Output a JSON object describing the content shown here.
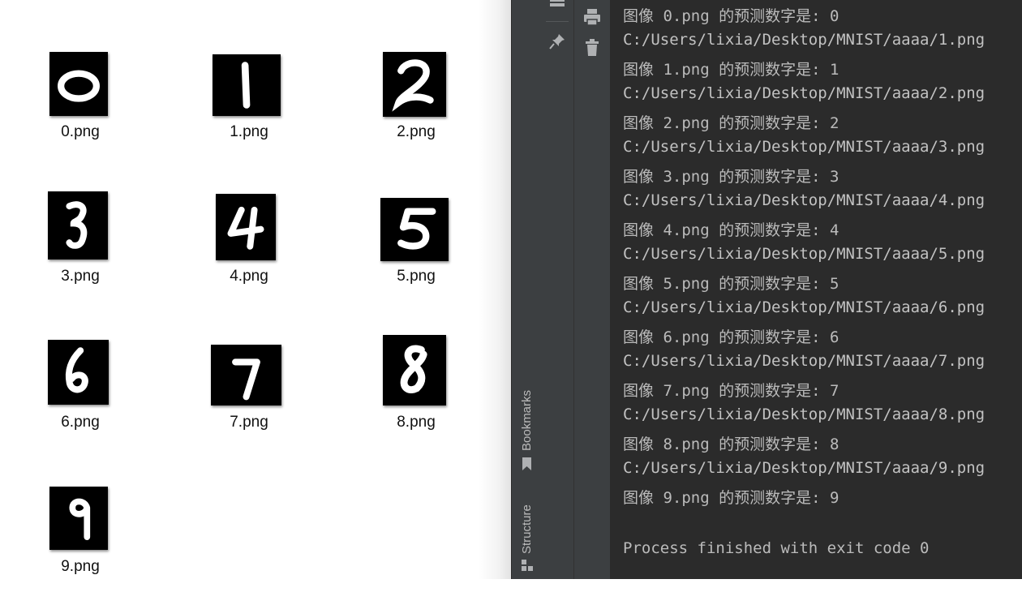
{
  "explorer": {
    "files": [
      {
        "name": "0.png",
        "digit": "0"
      },
      {
        "name": "1.png",
        "digit": "1"
      },
      {
        "name": "2.png",
        "digit": "2"
      },
      {
        "name": "3.png",
        "digit": "3"
      },
      {
        "name": "4.png",
        "digit": "4"
      },
      {
        "name": "5.png",
        "digit": "5"
      },
      {
        "name": "6.png",
        "digit": "6"
      },
      {
        "name": "7.png",
        "digit": "7"
      },
      {
        "name": "8.png",
        "digit": "8"
      },
      {
        "name": "9.png",
        "digit": "9"
      }
    ]
  },
  "ide": {
    "side_tabs": {
      "bookmarks": "Bookmarks",
      "structure": "Structure"
    },
    "icons": [
      "layout-icon",
      "pin-icon",
      "print-icon",
      "trash-icon",
      "bookmark-icon",
      "structure-icon"
    ]
  },
  "console": {
    "lines": [
      "图像 0.png 的预测数字是: 0",
      "C:/Users/lixia/Desktop/MNIST/aaaa/1.png",
      "图像 1.png 的预测数字是: 1",
      "C:/Users/lixia/Desktop/MNIST/aaaa/2.png",
      "图像 2.png 的预测数字是: 2",
      "C:/Users/lixia/Desktop/MNIST/aaaa/3.png",
      "图像 3.png 的预测数字是: 3",
      "C:/Users/lixia/Desktop/MNIST/aaaa/4.png",
      "图像 4.png 的预测数字是: 4",
      "C:/Users/lixia/Desktop/MNIST/aaaa/5.png",
      "图像 5.png 的预测数字是: 5",
      "C:/Users/lixia/Desktop/MNIST/aaaa/6.png",
      "图像 6.png 的预测数字是: 6",
      "C:/Users/lixia/Desktop/MNIST/aaaa/7.png",
      "图像 7.png 的预测数字是: 7",
      "C:/Users/lixia/Desktop/MNIST/aaaa/8.png",
      "图像 8.png 的预测数字是: 8",
      "C:/Users/lixia/Desktop/MNIST/aaaa/9.png",
      "图像 9.png 的预测数字是: 9",
      "",
      "Process finished with exit code 0"
    ]
  },
  "colors": {
    "console_bg": "#2b2b2b",
    "console_text": "#bbbbbb",
    "toolwindow_bg": "#3c3f41",
    "thumbnail_bg": "#000000",
    "digit_stroke": "#ffffff"
  }
}
